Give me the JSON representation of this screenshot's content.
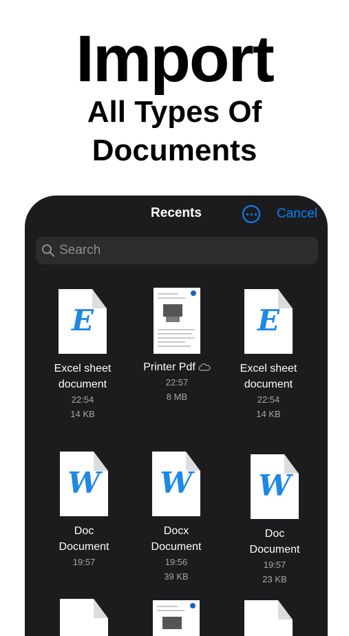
{
  "headline": {
    "line1": "Import",
    "line2": "All Types Of",
    "line3": "Documents"
  },
  "nav": {
    "title": "Recents",
    "cancel": "Cancel",
    "more_icon": "ellipsis-circle-icon"
  },
  "search": {
    "placeholder": "Search"
  },
  "files": [
    {
      "icon": "E",
      "name1": "Excel sheet",
      "name2": "document",
      "time": "22:54",
      "size": "14 KB"
    },
    {
      "icon": "pdf",
      "name1": "Printer Pdf",
      "name2": "",
      "time": "22:57",
      "size": "8 MB"
    },
    {
      "icon": "E",
      "name1": "Excel sheet",
      "name2": "document",
      "time": "22:54",
      "size": "14 KB"
    },
    {
      "icon": "W",
      "name1": "Doc",
      "name2": "Document",
      "time": "19:57",
      "size": ""
    },
    {
      "icon": "W",
      "name1": "Docx",
      "name2": "Document",
      "time": "19:56",
      "size": "39 KB"
    },
    {
      "icon": "W",
      "name1": "Doc",
      "name2": "Document",
      "time": "19:57",
      "size": "23 KB"
    }
  ],
  "colors": {
    "accent": "#0a84ff",
    "sheet_bg": "#1c1c1e",
    "doc_letter": "#1e88e5"
  }
}
